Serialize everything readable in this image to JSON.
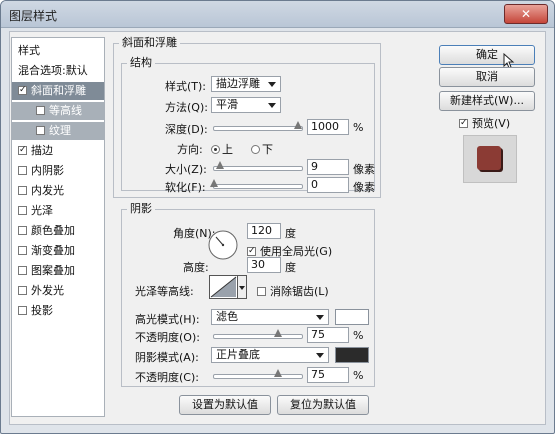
{
  "window": {
    "title": "图层样式",
    "close_label": "✕"
  },
  "left": {
    "styles_label": "样式",
    "blend_default": "混合选项:默认",
    "items": [
      {
        "label": "斜面和浮雕",
        "checked": true
      },
      {
        "label": "等高线",
        "checked": false
      },
      {
        "label": "纹理",
        "checked": false
      },
      {
        "label": "描边",
        "checked": true
      },
      {
        "label": "内阴影",
        "checked": false
      },
      {
        "label": "内发光",
        "checked": false
      },
      {
        "label": "光泽",
        "checked": false
      },
      {
        "label": "颜色叠加",
        "checked": false
      },
      {
        "label": "渐变叠加",
        "checked": false
      },
      {
        "label": "图案叠加",
        "checked": false
      },
      {
        "label": "外发光",
        "checked": false
      },
      {
        "label": "投影",
        "checked": false
      }
    ]
  },
  "bevel": {
    "group_title": "斜面和浮雕",
    "structure_title": "结构",
    "style_label": "样式(T):",
    "style_value": "描边浮雕",
    "method_label": "方法(Q):",
    "method_value": "平滑",
    "depth_label": "深度(D):",
    "depth_value": "1000",
    "depth_unit": "%",
    "direction_label": "方向:",
    "dir_up": "上",
    "dir_down": "下",
    "size_label": "大小(Z):",
    "size_value": "9",
    "size_unit": "像素",
    "soften_label": "软化(F):",
    "soften_value": "0",
    "soften_unit": "像素"
  },
  "shading": {
    "title": "阴影",
    "angle_label": "角度(N):",
    "angle_value": "120",
    "angle_unit": "度",
    "global_light_label": "使用全局光(G)",
    "altitude_label": "高度:",
    "altitude_value": "30",
    "altitude_unit": "度",
    "gloss_label": "光泽等高线:",
    "antialias_label": "消除锯齿(L)",
    "highlight_mode_label": "高光模式(H):",
    "highlight_mode_value": "滤色",
    "highlight_opacity_label": "不透明度(O):",
    "highlight_opacity_value": "75",
    "highlight_opacity_unit": "%",
    "shadow_mode_label": "阴影模式(A):",
    "shadow_mode_value": "正片叠底",
    "shadow_opacity_label": "不透明度(C):",
    "shadow_opacity_value": "75",
    "shadow_opacity_unit": "%",
    "highlight_color": "#ffffff",
    "shadow_color": "#2b2b2b"
  },
  "footer": {
    "set_default": "设置为默认值",
    "reset_default": "复位为默认值"
  },
  "right": {
    "ok": "确定",
    "cancel": "取消",
    "new_style": "新建样式(W)...",
    "preview_label": "预览(V)",
    "preview_color": "#8b3b34"
  }
}
